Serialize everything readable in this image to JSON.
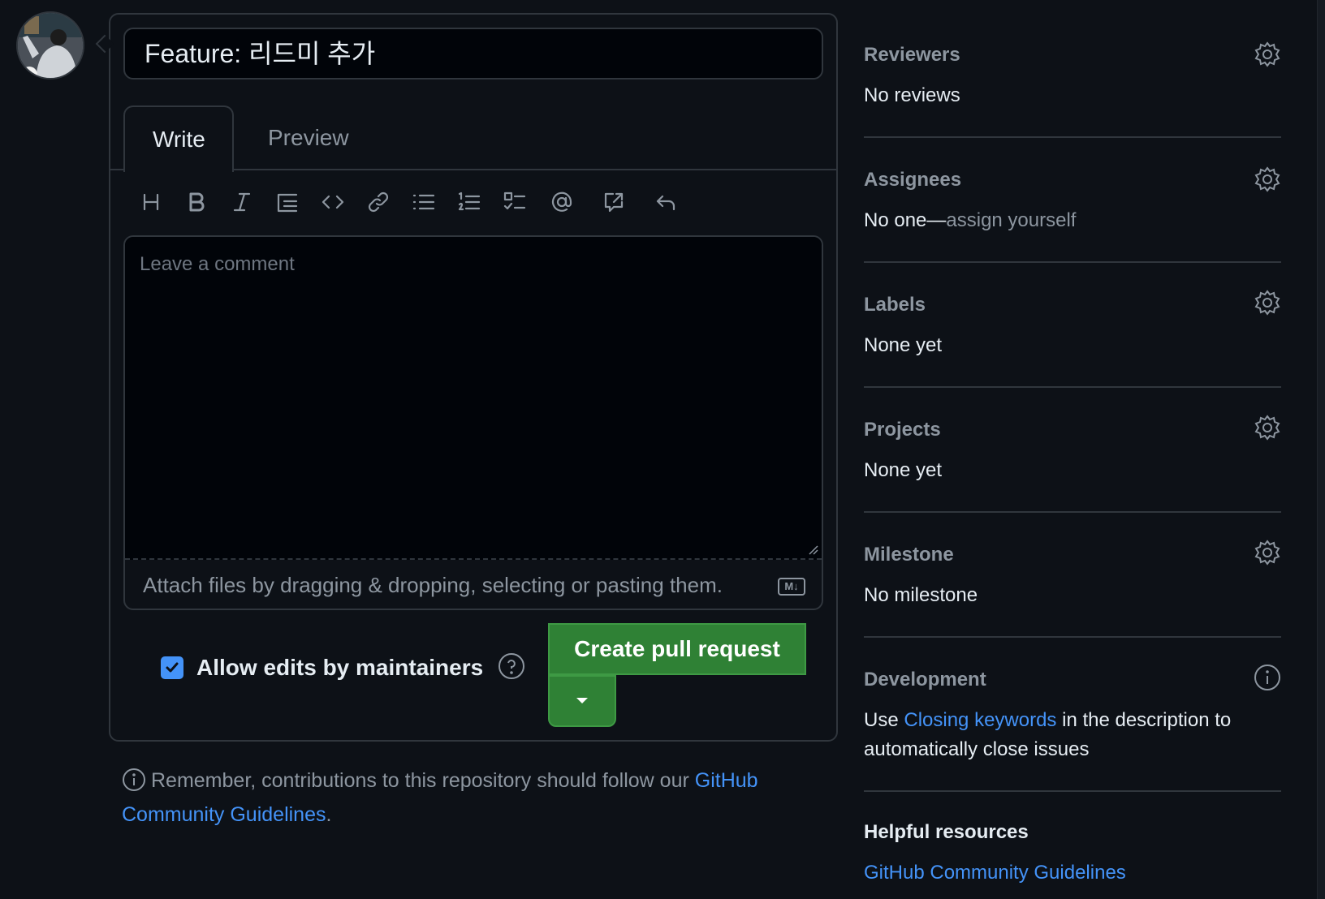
{
  "title_input": {
    "value": "Feature: 리드미 추가"
  },
  "tabs": [
    {
      "label": "Write",
      "active": true
    },
    {
      "label": "Preview",
      "active": false
    }
  ],
  "toolbar": {
    "tools": [
      "heading-icon",
      "bold-icon",
      "italic-icon",
      "quote-icon",
      "code-icon",
      "link-icon",
      "bullet-list-icon",
      "numbered-list-icon",
      "task-list-icon",
      "mention-icon",
      "cross-reference-icon",
      "reply-icon"
    ]
  },
  "comment": {
    "placeholder": "Leave a comment",
    "attach_text": "Attach files by dragging & dropping, selecting or pasting them.",
    "markdown_badge": "M↓"
  },
  "allow_edits": {
    "label": "Allow edits by maintainers",
    "checked": true
  },
  "create_button": {
    "label": "Create pull request"
  },
  "reminder": {
    "text": "Remember, contributions to this repository should follow our ",
    "link": "GitHub Community Guidelines",
    "end": "."
  },
  "sidebar": {
    "reviewers": {
      "title": "Reviewers",
      "value": "No reviews"
    },
    "assignees": {
      "title": "Assignees",
      "value_prefix": "No one—",
      "value_link": "assign yourself"
    },
    "labels": {
      "title": "Labels",
      "value": "None yet"
    },
    "projects": {
      "title": "Projects",
      "value": "None yet"
    },
    "milestone": {
      "title": "Milestone",
      "value": "No milestone"
    },
    "development": {
      "title": "Development",
      "text_prefix": "Use ",
      "link": "Closing keywords",
      "text_suffix": " in the description to automatically close issues"
    },
    "resources": {
      "title": "Helpful resources",
      "link": "GitHub Community Guidelines"
    }
  },
  "colors": {
    "background": "#0d1117",
    "border": "#30363d",
    "link": "#4493f8",
    "primary_button": "#2f8135",
    "muted_text": "#8d96a0"
  }
}
